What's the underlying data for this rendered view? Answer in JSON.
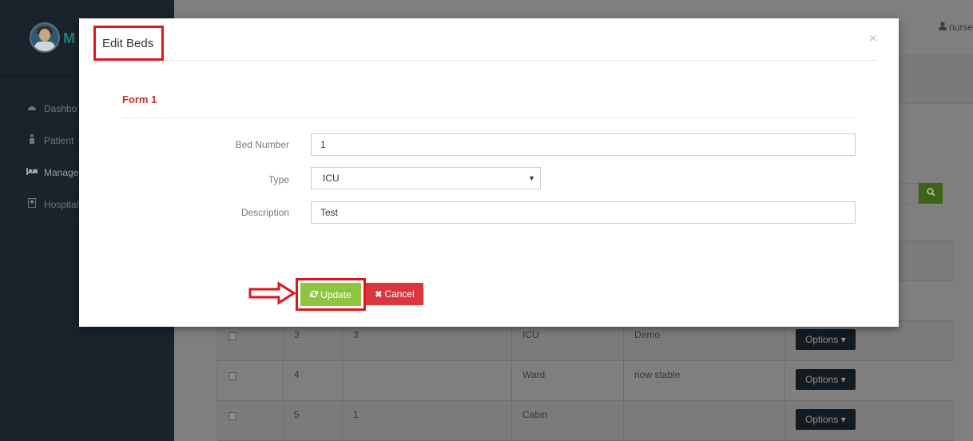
{
  "sidebar": {
    "brand": "M",
    "items": [
      {
        "label": "Dashbo",
        "icon": "dashboard-icon"
      },
      {
        "label": "Patient",
        "icon": "person-icon"
      },
      {
        "label": "Manage",
        "icon": "bed-icon"
      },
      {
        "label": "Hospital",
        "icon": "hospital-icon"
      }
    ]
  },
  "header": {
    "user": "nurse"
  },
  "table": {
    "rows": [
      {
        "id": "3",
        "bed": "3",
        "type": "ICU",
        "description": "Demo",
        "options": "Options"
      },
      {
        "id": "4",
        "bed": "",
        "type": "Ward",
        "description": "now stable",
        "options": "Options"
      },
      {
        "id": "5",
        "bed": "1",
        "type": "Cabin",
        "description": "",
        "options": "Options"
      }
    ]
  },
  "modal": {
    "title": "Edit Beds",
    "close": "×",
    "form_title": "Form 1",
    "fields": {
      "bed_number_label": "Bed Number",
      "bed_number_value": "1",
      "type_label": "Type",
      "type_value": "ICU",
      "description_label": "Description",
      "description_value": "Test"
    },
    "update_label": "Update",
    "cancel_label": "Cancel"
  },
  "colors": {
    "update": "#8cc540",
    "cancel": "#d9363e",
    "highlight": "#e0151c",
    "form_title": "#c9302c"
  }
}
